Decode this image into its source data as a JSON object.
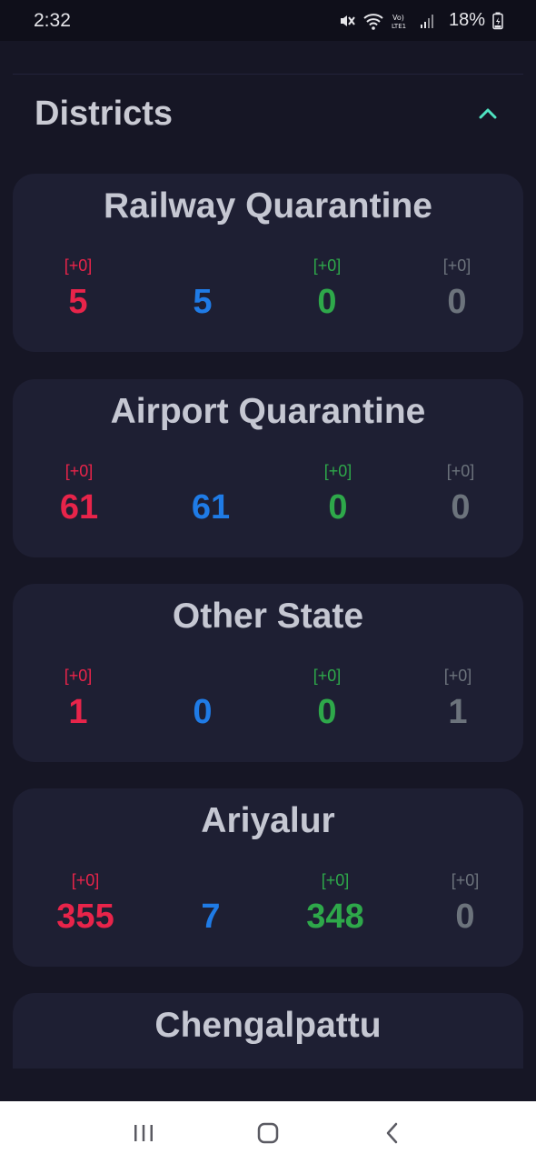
{
  "status_bar": {
    "time": "2:32",
    "battery": "18%",
    "icons": [
      "mute-icon",
      "wifi-icon",
      "volte-icon",
      "signal-icon",
      "battery-icon"
    ]
  },
  "section": {
    "title": "Districts",
    "collapse_icon": "chevron-up-icon"
  },
  "colors": {
    "confirmed": "#e8244a",
    "active": "#1f7be6",
    "recovered": "#2ea84a",
    "deceased": "#6c737c",
    "accent": "#4fe3c1"
  },
  "districts": [
    {
      "name": "Railway Quarantine",
      "confirmed": {
        "delta": "[+0]",
        "value": "5"
      },
      "active": {
        "value": "5"
      },
      "recovered": {
        "delta": "[+0]",
        "value": "0"
      },
      "deceased": {
        "delta": "[+0]",
        "value": "0"
      }
    },
    {
      "name": "Airport Quarantine",
      "confirmed": {
        "delta": "[+0]",
        "value": "61"
      },
      "active": {
        "value": "61"
      },
      "recovered": {
        "delta": "[+0]",
        "value": "0"
      },
      "deceased": {
        "delta": "[+0]",
        "value": "0"
      }
    },
    {
      "name": "Other State",
      "confirmed": {
        "delta": "[+0]",
        "value": "1"
      },
      "active": {
        "value": "0"
      },
      "recovered": {
        "delta": "[+0]",
        "value": "0"
      },
      "deceased": {
        "delta": "[+0]",
        "value": "1"
      }
    },
    {
      "name": "Ariyalur",
      "confirmed": {
        "delta": "[+0]",
        "value": "355"
      },
      "active": {
        "value": "7"
      },
      "recovered": {
        "delta": "[+0]",
        "value": "348"
      },
      "deceased": {
        "delta": "[+0]",
        "value": "0"
      }
    },
    {
      "name": "Chengalpattu"
    }
  ],
  "nav_bar": {
    "icons": [
      "recent-apps-icon",
      "home-icon",
      "back-icon"
    ]
  }
}
